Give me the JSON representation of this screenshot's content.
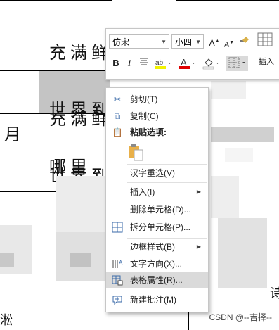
{
  "document": {
    "cell1_lines": [
      "充满鲜花的",
      "世界到",
      "哪里"
    ],
    "cell2_lines": [
      "充满鲜花的",
      "世界到"
    ],
    "side_char": "月",
    "edge_char_right": "诗",
    "edge_char_left": "淞"
  },
  "mini_toolbar": {
    "font_name": "仿宋",
    "font_size": "小四",
    "grow_font": "A",
    "shrink_font": "A",
    "bold": "B",
    "italic": "I",
    "insert_label": "插入"
  },
  "context_menu": {
    "items": [
      {
        "label": "剪切(T)",
        "icon": "scissors-icon"
      },
      {
        "label": "复制(C)",
        "icon": "copy-icon"
      },
      {
        "label": "粘贴选项:",
        "icon": "paste-icon"
      },
      {
        "label": "汉字重选(V)",
        "icon": ""
      },
      {
        "label": "插入(I)",
        "icon": ""
      },
      {
        "label": "删除单元格(D)...",
        "icon": ""
      },
      {
        "label": "拆分单元格(P)...",
        "icon": "split-cells-icon"
      },
      {
        "label": "边框样式(B)",
        "icon": ""
      },
      {
        "label": "文字方向(X)...",
        "icon": "text-direction-icon"
      },
      {
        "label": "表格属性(R)...",
        "icon": "table-properties-icon"
      },
      {
        "label": "新建批注(M)",
        "icon": "new-comment-icon"
      }
    ],
    "highlighted_item": "表格属性(R)..."
  },
  "watermark": "CSDN @--吉择--"
}
